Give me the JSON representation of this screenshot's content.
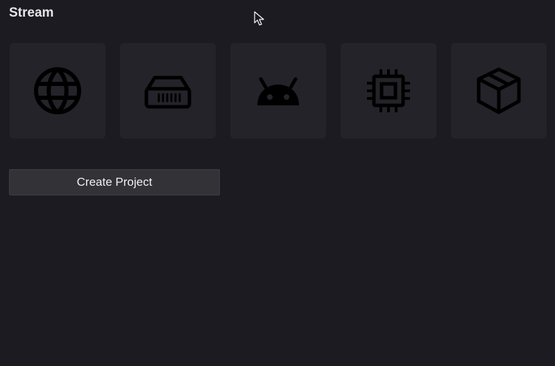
{
  "header": {
    "title": "Stream"
  },
  "templates": [
    {
      "icon": "globe-icon"
    },
    {
      "icon": "server-icon"
    },
    {
      "icon": "android-icon"
    },
    {
      "icon": "cpu-chip-icon"
    },
    {
      "icon": "package-box-icon"
    }
  ],
  "actions": {
    "create_label": "Create Project"
  },
  "colors": {
    "background": "#1c1b21",
    "tile": "#242329",
    "button": "#323237",
    "text": "#e6e6ea",
    "icon": "#000000"
  }
}
